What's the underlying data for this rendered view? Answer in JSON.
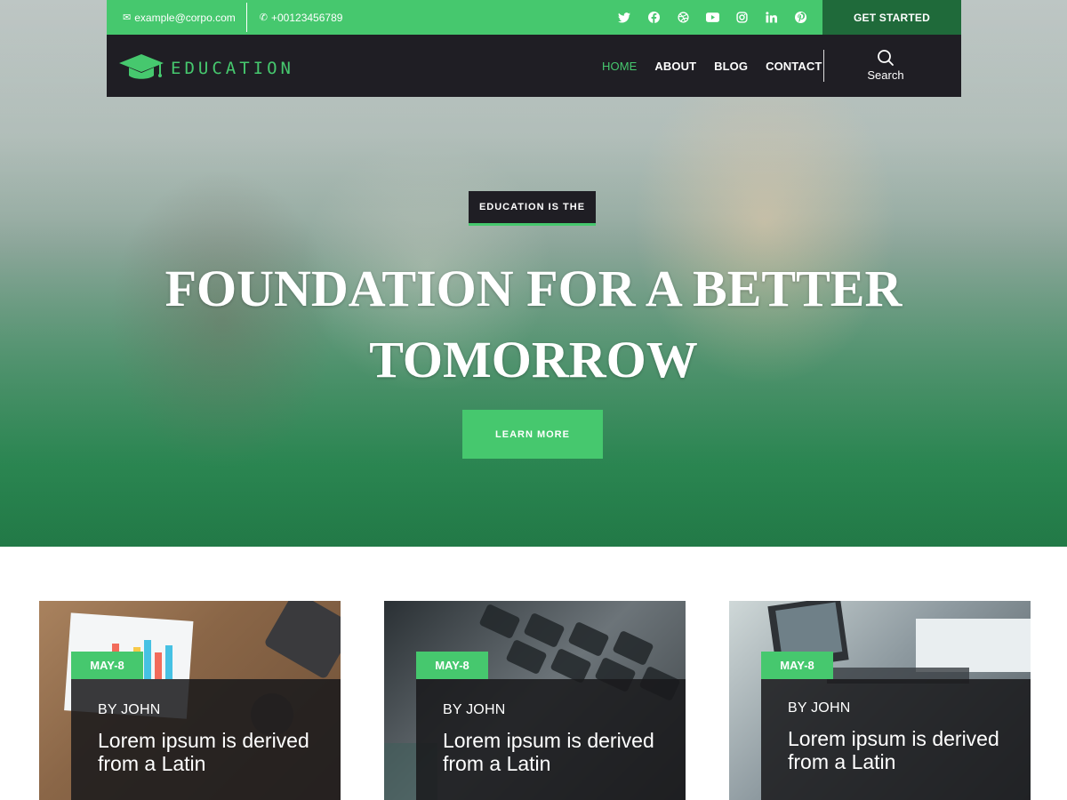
{
  "topbar": {
    "email": "example@corpo.com",
    "phone": "+00123456789",
    "socials": [
      "twitter-icon",
      "facebook-icon",
      "dribbble-icon",
      "youtube-icon",
      "instagram-icon",
      "linkedin-icon",
      "pinterest-icon"
    ],
    "cta": "GET STARTED"
  },
  "nav": {
    "logo": "EDUCATION",
    "items": [
      {
        "label": "HOME",
        "active": true
      },
      {
        "label": "ABOUT"
      },
      {
        "label": "BLOG"
      },
      {
        "label": "CONTACT"
      }
    ],
    "search": "Search"
  },
  "hero": {
    "eyebrow": "EDUCATION IS THE",
    "headline_line1": "FOUNDATION FOR A BETTER",
    "headline_line2": "TOMORROW",
    "button": "LEARN MORE"
  },
  "cards": [
    {
      "date": "MAY-8",
      "author": "BY JOHN",
      "title_line1": "Lorem ipsum is derived",
      "title_line2": "from a Latin"
    },
    {
      "date": "MAY-8",
      "author": "BY JOHN",
      "title_line1": "Lorem ipsum is derived",
      "title_line2": "from a Latin"
    },
    {
      "date": "MAY-8",
      "author": "BY JOHN",
      "title_line1": "Lorem ipsum is derived",
      "title_line2": "from a Latin"
    }
  ],
  "colors": {
    "accent": "#46c86e",
    "dark": "#1f1e24",
    "cta_dark": "#1f6a3a"
  }
}
